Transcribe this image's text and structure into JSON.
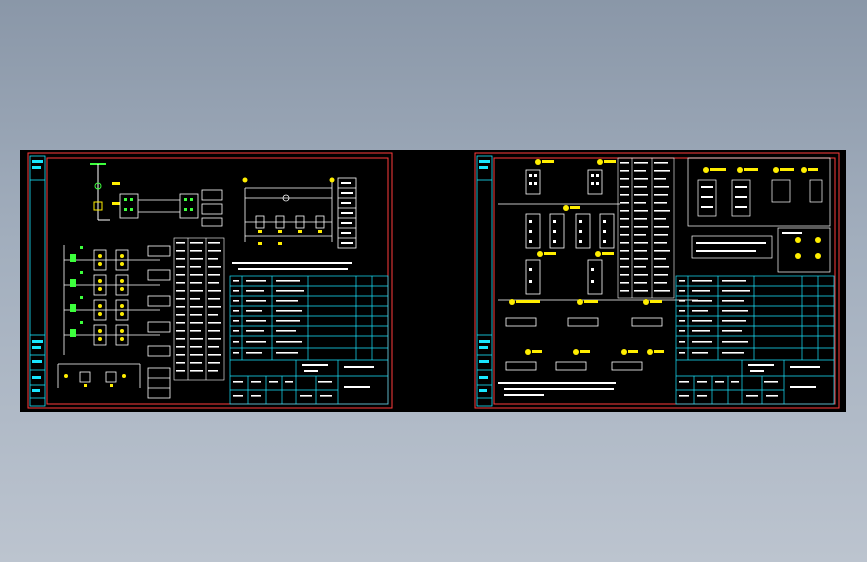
{
  "viewer": {
    "background_top": "#8a97a8",
    "background_bottom": "#bcc4cf",
    "canvas_color": "#000000"
  },
  "sheets": [
    {
      "id": "sheet-left",
      "title_block": {
        "name": "",
        "number": ""
      },
      "notes": []
    },
    {
      "id": "sheet-right",
      "title_block": {
        "name": "",
        "number": ""
      },
      "notes": []
    }
  ],
  "palette": {
    "frame": "#ff3b3b",
    "table": "#19e6ff",
    "wiring": "#ffffff",
    "symbol_green": "#3cff3c",
    "symbol_yellow": "#ffee00",
    "text": "#ffffff"
  }
}
